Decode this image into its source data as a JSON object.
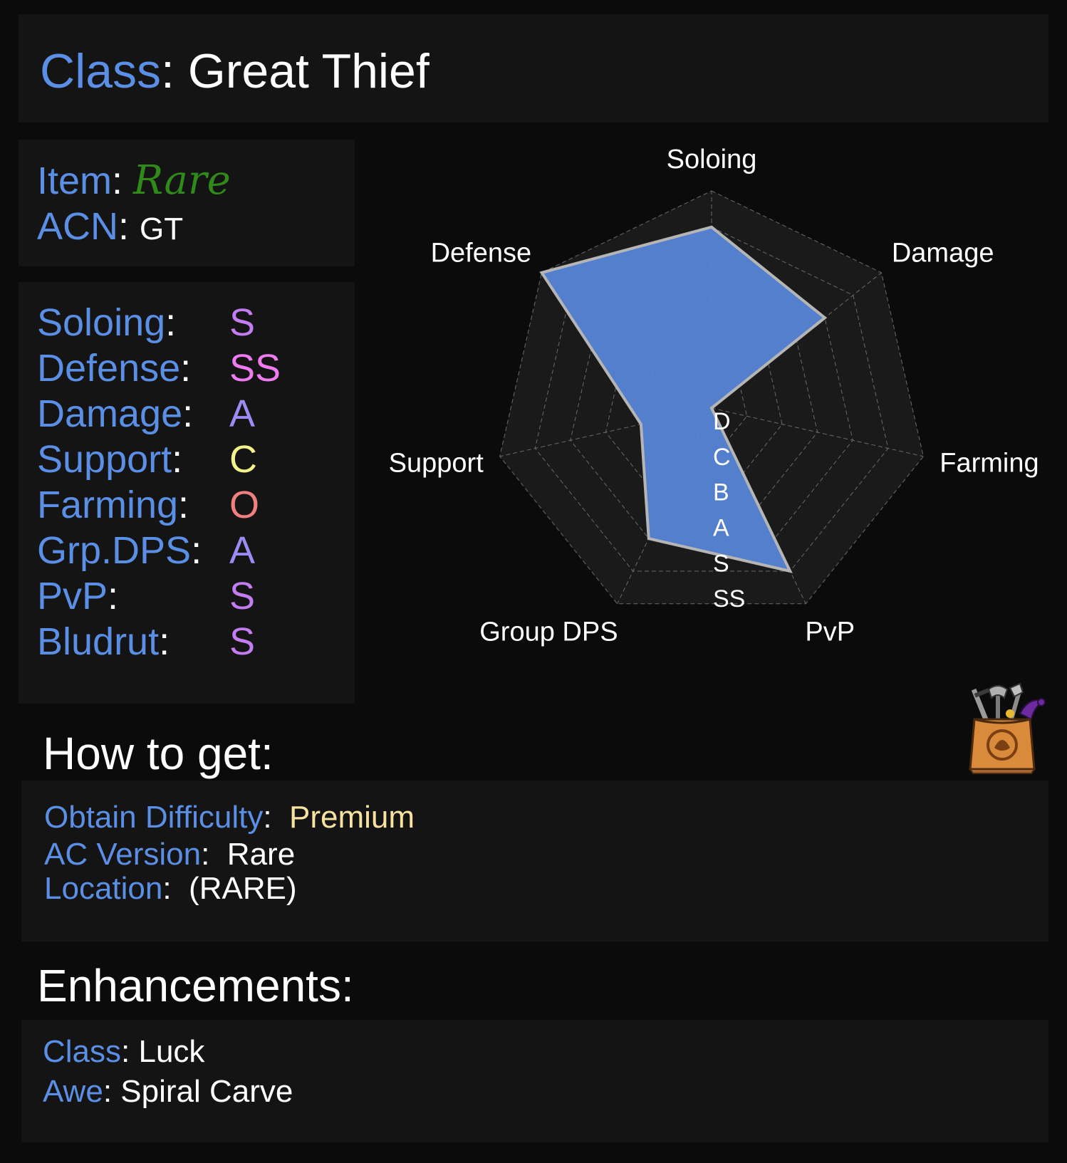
{
  "header": {
    "class_label": "Class",
    "class_value": "Great Thief"
  },
  "item_info": {
    "item_label": "Item",
    "item_value": "Rare",
    "acn_label": "ACN",
    "acn_value": "GT"
  },
  "stats": [
    {
      "label": "Soloing",
      "grade": "S",
      "color": "#c37df0"
    },
    {
      "label": "Defense",
      "grade": "SS",
      "color": "#f07bf0"
    },
    {
      "label": "Damage",
      "grade": "A",
      "color": "#9a8cf2"
    },
    {
      "label": "Support",
      "grade": "C",
      "color": "#f2f28a"
    },
    {
      "label": "Farming",
      "grade": "O",
      "color": "#f08080"
    },
    {
      "label": "Grp.DPS",
      "grade": "A",
      "color": "#9a8cf2"
    },
    {
      "label": "PvP",
      "grade": "S",
      "color": "#c37df0"
    },
    {
      "label": "Bludrut",
      "grade": "S",
      "color": "#c37df0"
    }
  ],
  "chart_data": {
    "type": "radar",
    "axes": [
      "Soloing",
      "Damage",
      "Farming",
      "PvP",
      "Group DPS",
      "Support",
      "Defense"
    ],
    "scale_labels": [
      "D",
      "C",
      "B",
      "A",
      "S",
      "SS"
    ],
    "values": [
      5,
      4,
      0,
      5,
      4,
      2,
      6
    ],
    "fill_color": "#5685d6",
    "stroke_color": "#b5b5b5"
  },
  "how_to_get": {
    "title": "How to get:",
    "difficulty_label": "Obtain Difficulty",
    "difficulty_value": "Premium",
    "difficulty_color": "#f7e2a0",
    "ac_version_label": "AC Version",
    "ac_version_value": "Rare",
    "location_label": "Location",
    "location_value": "(RARE)",
    "icon": "item-bag-icon"
  },
  "enhancements": {
    "title": "Enhancements:",
    "class_label": "Class",
    "class_value": "Luck",
    "awe_label": "Awe",
    "awe_value": "Spiral Carve"
  }
}
